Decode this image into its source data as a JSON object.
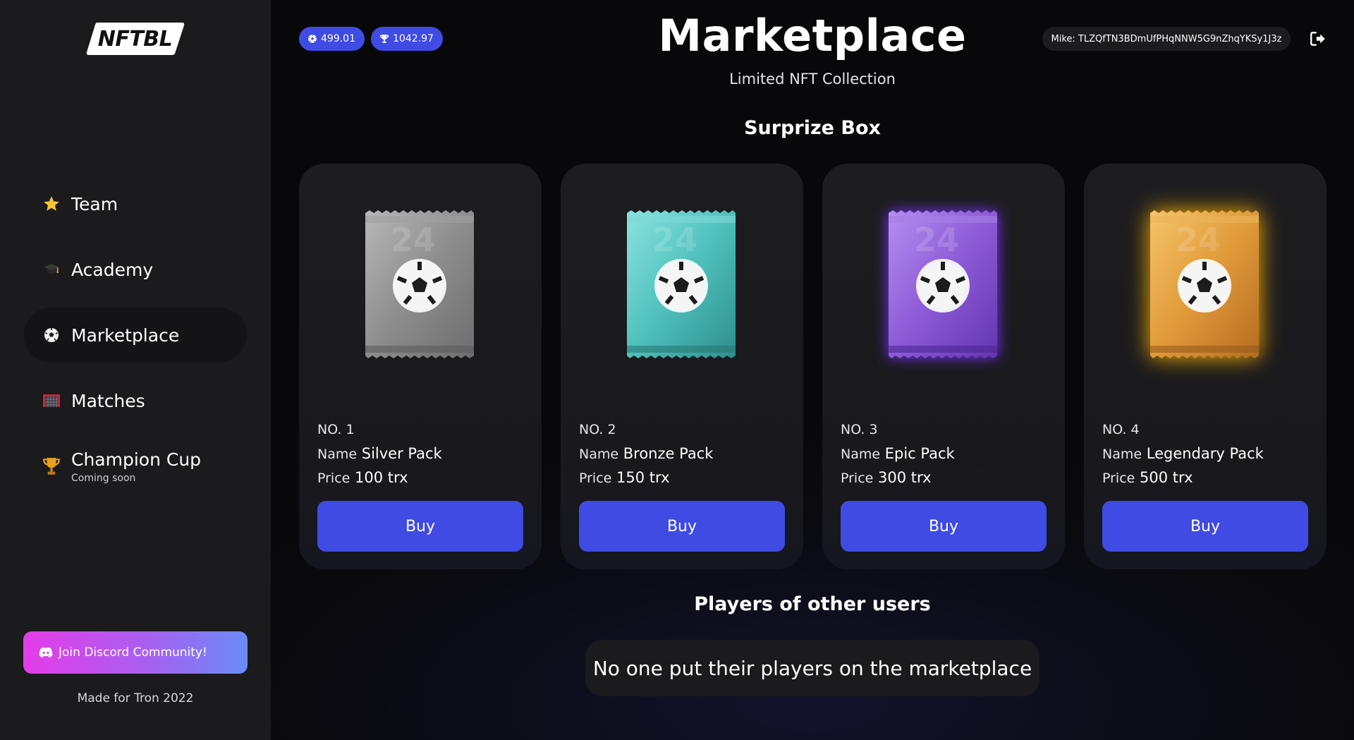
{
  "sidebar": {
    "logo_text": "NFTBL",
    "nav": [
      {
        "label": "Team",
        "icon": "star-icon"
      },
      {
        "label": "Academy",
        "icon": "graduation-cap-icon"
      },
      {
        "label": "Marketplace",
        "icon": "soccer-ball-icon",
        "active": true
      },
      {
        "label": "Matches",
        "icon": "goal-net-icon"
      },
      {
        "label": "Champion Cup",
        "sub": "Coming soon",
        "icon": "trophy-icon"
      }
    ],
    "discord_label": "Join Discord Community!",
    "made_for": "Made for Tron 2022"
  },
  "header": {
    "coins_value": "499.01",
    "trophy_value": "1042.97",
    "title": "Marketplace",
    "subtitle": "Limited NFT Collection",
    "user_label": "Mike: TLZQfTN3BDmUfPHqNNW5G9nZhqYKSy1J3z"
  },
  "surprize": {
    "title": "Surprize Box",
    "no_prefix": "NO.",
    "name_key": "Name",
    "price_key": "Price",
    "buy_label": "Buy",
    "packs": [
      {
        "no": "NO. 1",
        "name": "Silver Pack",
        "price": "100 trx",
        "color": "#9a9a9a"
      },
      {
        "no": "NO. 2",
        "name": "Bronze Pack",
        "price": "150 trx",
        "color": "#5cc7c4"
      },
      {
        "no": "NO. 3",
        "name": "Epic Pack",
        "price": "300 trx",
        "color": "#8d5ad6"
      },
      {
        "no": "NO. 4",
        "name": "Legendary Pack",
        "price": "500 trx",
        "color": "#e0a13e"
      }
    ]
  },
  "players": {
    "title": "Players of other users",
    "empty_message": "No one put their players on the marketplace"
  },
  "colors": {
    "accent": "#3f4be3",
    "sidebar_bg": "#1b1b1d",
    "card_bg": "#1d1d20"
  }
}
